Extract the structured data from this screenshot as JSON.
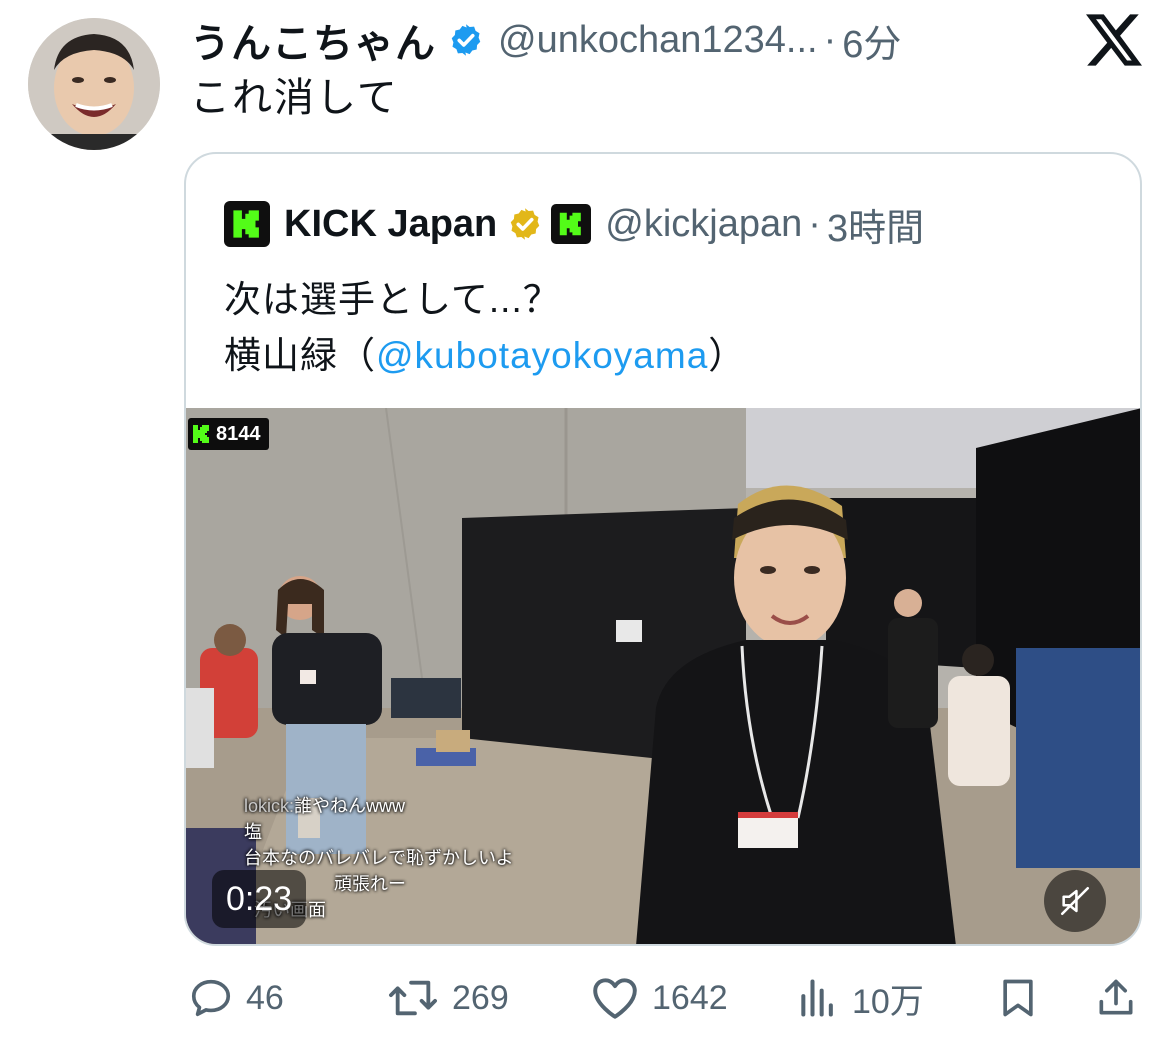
{
  "tweet": {
    "author_name": "うんこちゃん",
    "author_handle": "@unkochan1234...",
    "time_sep": "·",
    "time": "6分",
    "text": "これ消して"
  },
  "quote": {
    "name": "KICK Japan",
    "handle": "@kickjapan",
    "time_sep": "·",
    "time": "3時間",
    "line1": "次は選手として...？",
    "line2_prefix": "横山緑（",
    "line2_mention": "@kubotayokoyama",
    "line2_suffix": "）",
    "video": {
      "viewer_count": "8144",
      "timestamp": "0:23",
      "chat": [
        {
          "user": "lokick:",
          "text": "誰やねんwww"
        },
        {
          "user": "",
          "text": "塩"
        },
        {
          "user": "",
          "text": "台本なのバレバレで恥ずかしいよ"
        },
        {
          "user": "",
          "text": "頑張れー"
        },
        {
          "user": "",
          "text": "汚い画面"
        }
      ]
    }
  },
  "actions": {
    "replies": "46",
    "reposts": "269",
    "likes": "1642",
    "views": "10万"
  },
  "colors": {
    "brand_blue": "#1d9bf0",
    "secondary_text": "#536471",
    "kick_green": "#53fc18",
    "gold_badge": "#e2b719"
  },
  "icons": [
    "x-logo-icon",
    "verified-badge-icon",
    "gold-badge-icon",
    "kick-logo-icon",
    "mute-icon",
    "reply-icon",
    "repost-icon",
    "like-icon",
    "views-icon",
    "bookmark-icon",
    "share-icon"
  ]
}
